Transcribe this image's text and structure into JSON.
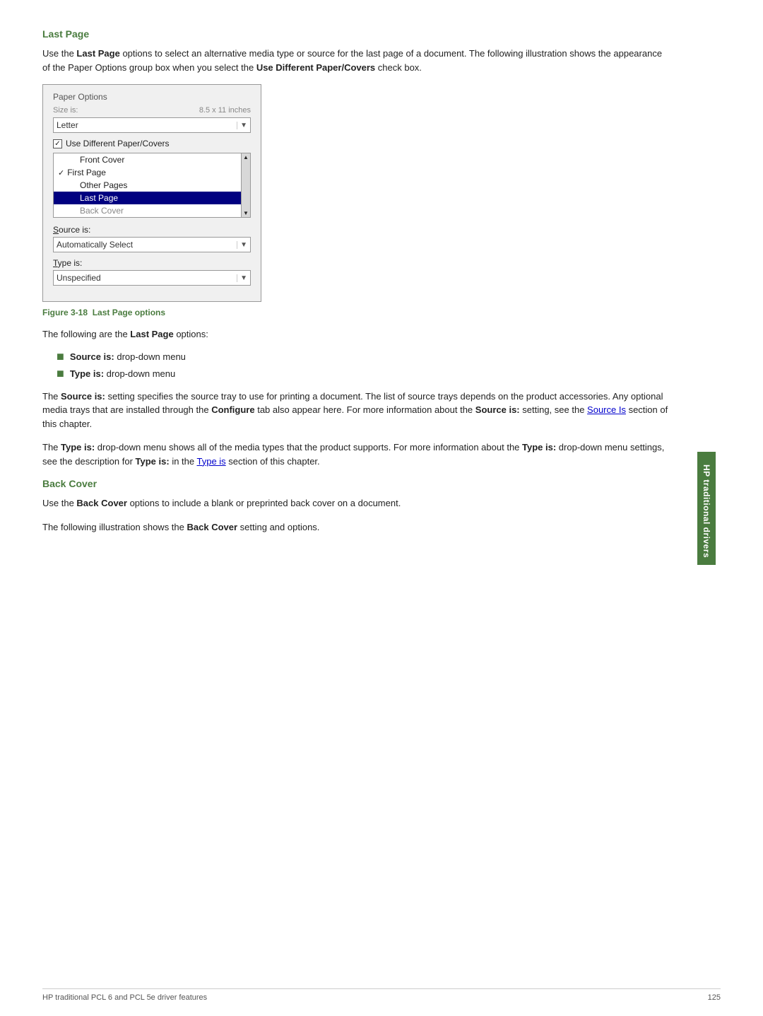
{
  "side_tab": {
    "label": "HP traditional drivers"
  },
  "section1": {
    "title": "Last Page",
    "intro": "Use the Last Page options to select an alternative media type or source for the last page of a document. The following illustration shows the appearance of the Paper Options group box when you select the Use Different Paper/Covers check box.",
    "figure": {
      "group_label": "Paper Options",
      "size_label": "Size is:",
      "size_value": "8.5 x 11 inches",
      "dropdown_value": "Letter",
      "checkbox_label": "Use Different Paper/Covers",
      "list_items": [
        {
          "label": "Front Cover",
          "checked": false,
          "selected": false
        },
        {
          "label": "First Page",
          "checked": true,
          "selected": false
        },
        {
          "label": "Other Pages",
          "checked": false,
          "selected": false
        },
        {
          "label": "Last Page",
          "checked": false,
          "selected": true
        },
        {
          "label": "Back Cover",
          "checked": false,
          "selected": false
        }
      ],
      "source_label": "Source is:",
      "source_underline": "S",
      "source_value": "Automatically Select",
      "type_label": "Type is:",
      "type_underline": "T",
      "type_value": "Unspecified"
    },
    "caption_prefix": "Figure 3-18",
    "caption_text": "Last Page options",
    "following_text": "The following are the Last Page options:",
    "bullets": [
      {
        "label": "Source is:",
        "rest": " drop-down menu"
      },
      {
        "label": "Type is:",
        "rest": " drop-down menu"
      }
    ],
    "para1_start": "The ",
    "para1_bold1": "Source is:",
    "para1_mid": " setting specifies the source tray to use for printing a document. The list of source trays depends on the product accessories. Any optional media trays that are installed through the ",
    "para1_bold2": "Configure",
    "para1_mid2": " tab also appear here. For more information about the ",
    "para1_bold3": "Source is:",
    "para1_mid3": " setting, see the ",
    "para1_link": "Source Is",
    "para1_end": " section of this chapter.",
    "para2_start": "The ",
    "para2_bold1": "Type is:",
    "para2_mid": " drop-down menu shows all of the media types that the product supports. For more information about the ",
    "para2_bold2": "Type is:",
    "para2_mid2": " drop-down menu settings, see the description for ",
    "para2_bold3": "Type is:",
    "para2_mid3": " in the ",
    "para2_link": "Type is",
    "para2_end": " section of this chapter."
  },
  "section2": {
    "title": "Back Cover",
    "para1": "Use the Back Cover options to include a blank or preprinted back cover on a document.",
    "para1_bold": "Back Cover",
    "para2_start": "The following illustration shows the ",
    "para2_bold": "Back Cover",
    "para2_end": " setting and options."
  },
  "footer": {
    "left": "HP traditional PCL 6 and PCL 5e driver features",
    "right": "125"
  }
}
